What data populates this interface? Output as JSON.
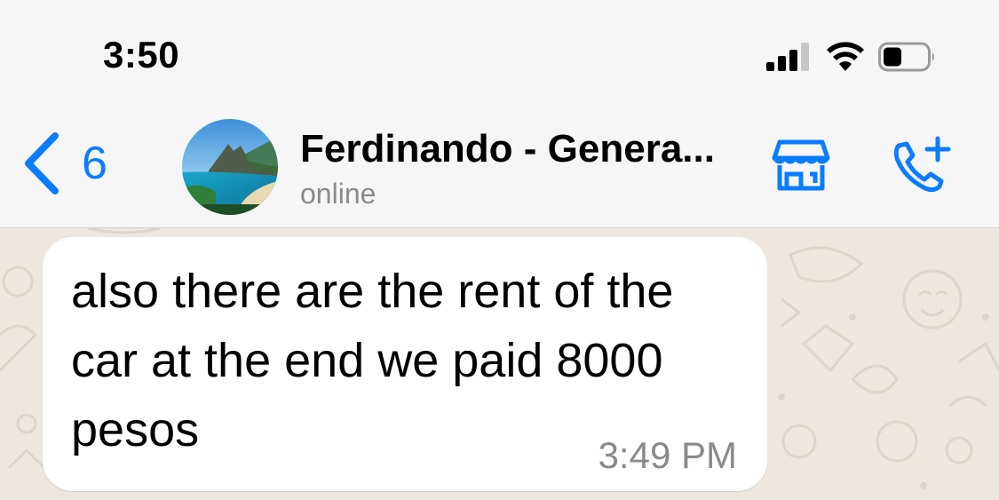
{
  "status_bar": {
    "time": "3:50",
    "icons": [
      "cellular-signal-icon",
      "wifi-icon",
      "battery-icon"
    ]
  },
  "header": {
    "back_count": "6",
    "contact_name": "Ferdinando - Genera...",
    "contact_status": "online",
    "icons": [
      "chevron-left-icon",
      "store-icon",
      "phone-plus-icon"
    ],
    "accent_color": "#0a7cff"
  },
  "chat": {
    "messages": [
      {
        "text": "also there are the rent of the car at the end we paid 8000 pesos",
        "time": "3:49 PM",
        "direction": "incoming"
      }
    ],
    "bubble_color": "#ffffff",
    "wallpaper_color": "#ede7df"
  }
}
